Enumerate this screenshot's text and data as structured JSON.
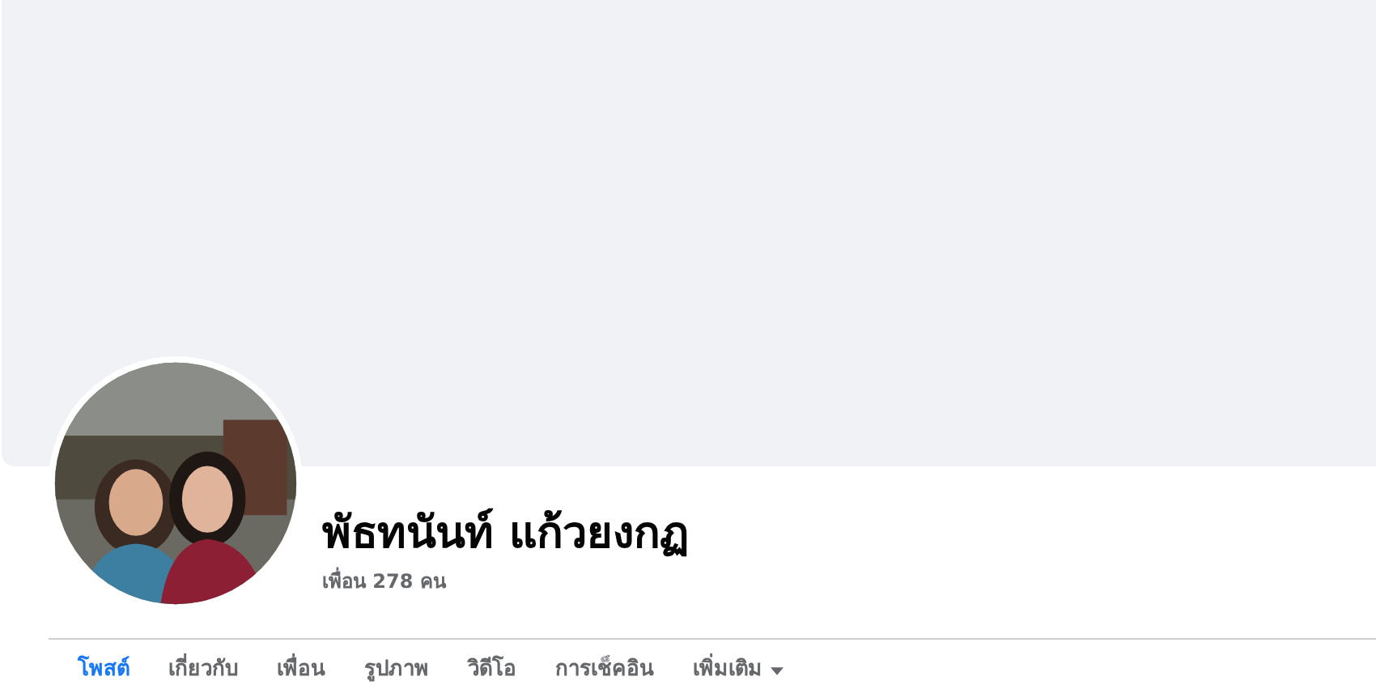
{
  "profile": {
    "name": "พัธทนันท์ แก้วยงกฏ",
    "friends": "เพื่อน 278 คน"
  },
  "tabs": [
    {
      "label": "โพสต์",
      "selected": true,
      "kind": "tab"
    },
    {
      "label": "เกี่ยวกับ",
      "selected": false,
      "kind": "tab"
    },
    {
      "label": "เพื่อน",
      "selected": false,
      "kind": "tab"
    },
    {
      "label": "รูปภาพ",
      "selected": false,
      "kind": "tab"
    },
    {
      "label": "วิดีโอ",
      "selected": false,
      "kind": "tab"
    },
    {
      "label": "การเช็คอิน",
      "selected": false,
      "kind": "tab"
    },
    {
      "label": "เพิ่มเติม",
      "selected": false,
      "kind": "menu"
    }
  ]
}
